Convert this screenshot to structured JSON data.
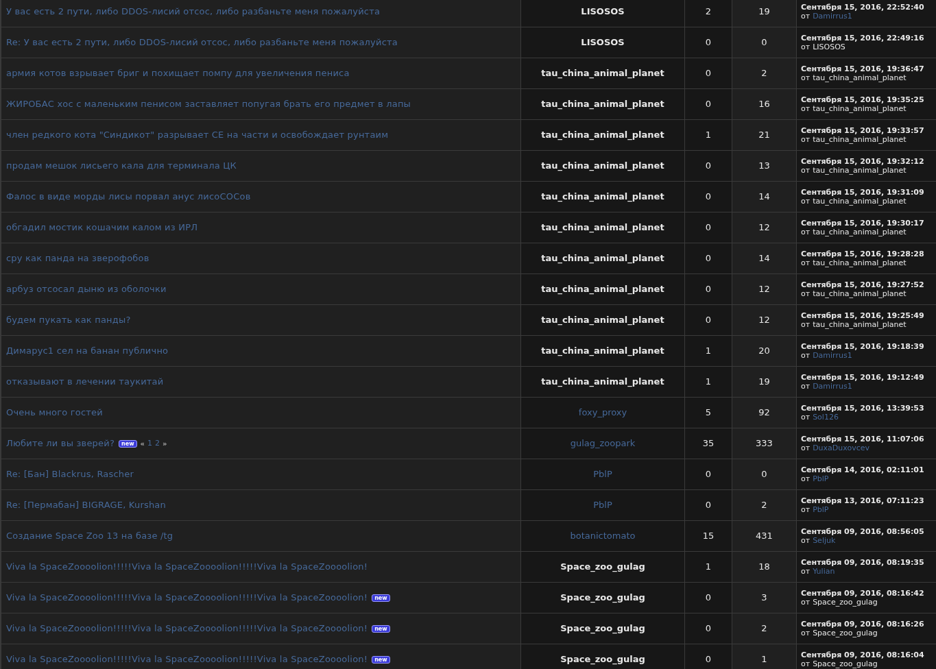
{
  "topics": [
    {
      "subject": "У вас есть 2 пути, либо DDOS-лисий отсос, либо разбаньте меня пожалуйста",
      "new": false,
      "author": "LISOSOS",
      "author_link": false,
      "replies": "2",
      "views": "19",
      "last_date": "Сентября 15, 2016, 22:52:40",
      "last_prefix": "от",
      "last_by": "Damirrus1",
      "last_by_link": true
    },
    {
      "subject": "Re: У вас есть 2 пути, либо DDOS-лисий отсос, либо разбаньте меня пожалуйста",
      "new": false,
      "author": "LISOSOS",
      "author_link": false,
      "replies": "0",
      "views": "0",
      "last_date": "Сентября 15, 2016, 22:49:16",
      "last_prefix": "от",
      "last_by": "LISOSOS",
      "last_by_link": false
    },
    {
      "subject": "армия котов взрывает бриг и похищает помпу для увеличения пениса",
      "new": false,
      "author": "tau_china_animal_planet",
      "author_link": false,
      "replies": "0",
      "views": "2",
      "last_date": "Сентября 15, 2016, 19:36:47",
      "last_prefix": "от",
      "last_by": "tau_china_animal_planet",
      "last_by_link": false
    },
    {
      "subject": "ЖИРОБАС хос с маленьким пенисом заставляет попугая брать его предмет в лапы",
      "new": false,
      "author": "tau_china_animal_planet",
      "author_link": false,
      "replies": "0",
      "views": "16",
      "last_date": "Сентября 15, 2016, 19:35:25",
      "last_prefix": "от",
      "last_by": "tau_china_animal_planet",
      "last_by_link": false
    },
    {
      "subject": "член редкого кота \"Синдикот\" разрывает СЕ на части и освобождает рунтаим",
      "new": false,
      "author": "tau_china_animal_planet",
      "author_link": false,
      "replies": "1",
      "views": "21",
      "last_date": "Сентября 15, 2016, 19:33:57",
      "last_prefix": "от",
      "last_by": "tau_china_animal_planet",
      "last_by_link": false
    },
    {
      "subject": "продам мешок лисьего кала для терминала ЦК",
      "new": false,
      "author": "tau_china_animal_planet",
      "author_link": false,
      "replies": "0",
      "views": "13",
      "last_date": "Сентября 15, 2016, 19:32:12",
      "last_prefix": "от",
      "last_by": "tau_china_animal_planet",
      "last_by_link": false
    },
    {
      "subject": "Фалос в виде морды лисы порвал анус лисоСОСов",
      "new": false,
      "author": "tau_china_animal_planet",
      "author_link": false,
      "replies": "0",
      "views": "14",
      "last_date": "Сентября 15, 2016, 19:31:09",
      "last_prefix": "от",
      "last_by": "tau_china_animal_planet",
      "last_by_link": false
    },
    {
      "subject": "обгадил мостик кошачим калом из ИРЛ",
      "new": false,
      "author": "tau_china_animal_planet",
      "author_link": false,
      "replies": "0",
      "views": "12",
      "last_date": "Сентября 15, 2016, 19:30:17",
      "last_prefix": "от",
      "last_by": "tau_china_animal_planet",
      "last_by_link": false
    },
    {
      "subject": "сру как панда на зверофобов",
      "new": false,
      "author": "tau_china_animal_planet",
      "author_link": false,
      "replies": "0",
      "views": "14",
      "last_date": "Сентября 15, 2016, 19:28:28",
      "last_prefix": "от",
      "last_by": "tau_china_animal_planet",
      "last_by_link": false
    },
    {
      "subject": "арбуз отсосал дыню из оболочки",
      "new": false,
      "author": "tau_china_animal_planet",
      "author_link": false,
      "replies": "0",
      "views": "12",
      "last_date": "Сентября 15, 2016, 19:27:52",
      "last_prefix": "от",
      "last_by": "tau_china_animal_planet",
      "last_by_link": false
    },
    {
      "subject": "будем пукать как панды?",
      "new": false,
      "author": "tau_china_animal_planet",
      "author_link": false,
      "replies": "0",
      "views": "12",
      "last_date": "Сентября 15, 2016, 19:25:49",
      "last_prefix": "от",
      "last_by": "tau_china_animal_planet",
      "last_by_link": false
    },
    {
      "subject": "Димарус1 сел на банан публично",
      "new": false,
      "author": "tau_china_animal_planet",
      "author_link": false,
      "replies": "1",
      "views": "20",
      "last_date": "Сентября 15, 2016, 19:18:39",
      "last_prefix": "от",
      "last_by": "Damirrus1",
      "last_by_link": true
    },
    {
      "subject": "отказывают в лечении таукитай",
      "new": false,
      "author": "tau_china_animal_planet",
      "author_link": false,
      "replies": "1",
      "views": "19",
      "last_date": "Сентября 15, 2016, 19:12:49",
      "last_prefix": "от",
      "last_by": "Damirrus1",
      "last_by_link": true
    },
    {
      "subject": "Очень много гостей",
      "new": false,
      "author": "foxy_proxy",
      "author_link": true,
      "replies": "5",
      "views": "92",
      "last_date": "Сентября 15, 2016, 13:39:53",
      "last_prefix": "от",
      "last_by": "Sol126",
      "last_by_link": true
    },
    {
      "subject": "Любите ли вы зверей?",
      "new": true,
      "new_label": "new",
      "pager": {
        "prev": "«",
        "pages": [
          "1",
          "2"
        ],
        "next": "»"
      },
      "author": "gulag_zoopark",
      "author_link": true,
      "replies": "35",
      "views": "333",
      "last_date": "Сентября 15, 2016, 11:07:06",
      "last_prefix": "от",
      "last_by": "DuxaDuxovcev",
      "last_by_link": true
    },
    {
      "subject": "Re: [Бан] Blackrus, Rascher",
      "new": false,
      "author": "PblP",
      "author_link": true,
      "replies": "0",
      "views": "0",
      "last_date": "Сентября 14, 2016, 02:11:01",
      "last_prefix": "от",
      "last_by": "PblP",
      "last_by_link": true
    },
    {
      "subject": "Re: [Пермабан] BIGRAGE, Kurshan",
      "new": false,
      "author": "PblP",
      "author_link": true,
      "replies": "0",
      "views": "2",
      "last_date": "Сентября 13, 2016, 07:11:23",
      "last_prefix": "от",
      "last_by": "PblP",
      "last_by_link": true
    },
    {
      "subject": "Создание Space Zoo 13 на базе /tg",
      "new": false,
      "author": "botanictomato",
      "author_link": true,
      "replies": "15",
      "views": "431",
      "last_date": "Сентября 09, 2016, 08:56:05",
      "last_prefix": "от",
      "last_by": "Seljuk",
      "last_by_link": true
    },
    {
      "subject": "Viva la SpaceZoooolion!!!!!Viva la SpaceZoooolion!!!!!Viva la SpaceZoooolion!",
      "new": false,
      "author": "Space_zoo_gulag",
      "author_link": false,
      "replies": "1",
      "views": "18",
      "last_date": "Сентября 09, 2016, 08:19:35",
      "last_prefix": "от",
      "last_by": "Yulian",
      "last_by_link": true
    },
    {
      "subject": "Viva la SpaceZoooolion!!!!!Viva la SpaceZoooolion!!!!!Viva la SpaceZoooolion!",
      "new": true,
      "new_label": "new",
      "author": "Space_zoo_gulag",
      "author_link": false,
      "replies": "0",
      "views": "3",
      "last_date": "Сентября 09, 2016, 08:16:42",
      "last_prefix": "от",
      "last_by": "Space_zoo_gulag",
      "last_by_link": false
    },
    {
      "subject": "Viva la SpaceZoooolion!!!!!Viva la SpaceZoooolion!!!!!Viva la SpaceZoooolion!",
      "new": true,
      "new_label": "new",
      "author": "Space_zoo_gulag",
      "author_link": false,
      "replies": "0",
      "views": "2",
      "last_date": "Сентября 09, 2016, 08:16:26",
      "last_prefix": "от",
      "last_by": "Space_zoo_gulag",
      "last_by_link": false
    },
    {
      "subject": "Viva la SpaceZoooolion!!!!!Viva la SpaceZoooolion!!!!!Viva la SpaceZoooolion!",
      "new": true,
      "new_label": "new",
      "author": "Space_zoo_gulag",
      "author_link": false,
      "replies": "0",
      "views": "1",
      "last_date": "Сентября 09, 2016, 08:16:04",
      "last_prefix": "от",
      "last_by": "Space_zoo_gulag",
      "last_by_link": false
    }
  ]
}
